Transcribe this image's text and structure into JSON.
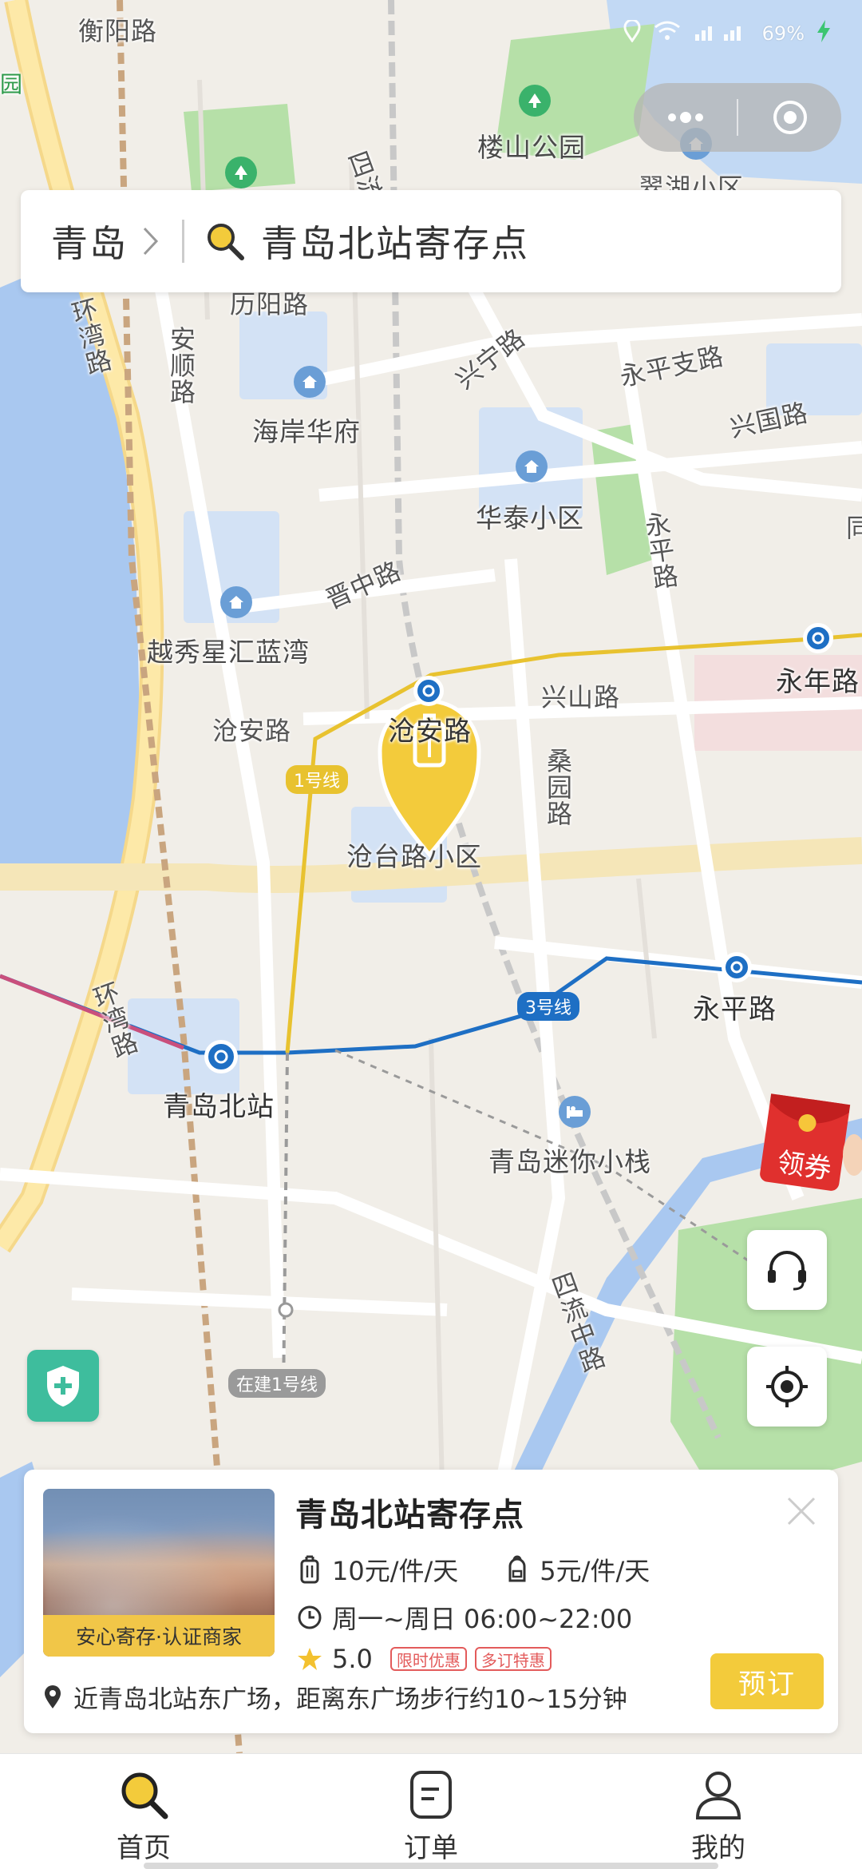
{
  "status_bar": {
    "battery": "69%"
  },
  "map": {
    "roads": [
      "衡阳路",
      "四流",
      "翠湖小区",
      "历阳路",
      "环湾路",
      "安顺路",
      "兴宁路",
      "永平支路",
      "兴国路",
      "永平路",
      "晋中路",
      "兴山路",
      "沧安路",
      "桑园路",
      "环湾路",
      "四流中路",
      "同"
    ],
    "pois": [
      "楼山公园",
      "海岸华府",
      "华泰小区",
      "越秀星汇蓝湾",
      "沧台路小区",
      "青岛迷你小栈"
    ],
    "stations": [
      "沧安路",
      "永年路",
      "永平路",
      "青岛北站"
    ],
    "lines": [
      "1号线",
      "3号线",
      "在建1号线"
    ],
    "edge_label": "园"
  },
  "capsule": {
    "more_icon": "more-dots-icon",
    "close_icon": "target-circle-icon"
  },
  "search": {
    "city": "青岛",
    "query": "青岛北站寄存点"
  },
  "coupon": {
    "label": "领券"
  },
  "card": {
    "title": "青岛北站寄存点",
    "thumb_label": "安心寄存·认证商家",
    "luggage_price": "10元/件/天",
    "bag_price": "5元/件/天",
    "hours": "周一~周日 06:00~22:00",
    "rating": "5.0",
    "tags": [
      "限时优惠",
      "多订特惠"
    ],
    "address": "近青岛北站东广场，距离东广场步行约10~15分钟",
    "book_label": "预订"
  },
  "nav": {
    "items": [
      {
        "label": "首页",
        "icon": "search-icon",
        "active": true
      },
      {
        "label": "订单",
        "icon": "order-icon",
        "active": false
      },
      {
        "label": "我的",
        "icon": "user-icon",
        "active": false
      }
    ]
  },
  "colors": {
    "accent": "#f3cb3b",
    "line1": "#e8c22f",
    "line3": "#1e6fc4",
    "water": "#a9c8f0",
    "park": "#b6e0a8"
  }
}
